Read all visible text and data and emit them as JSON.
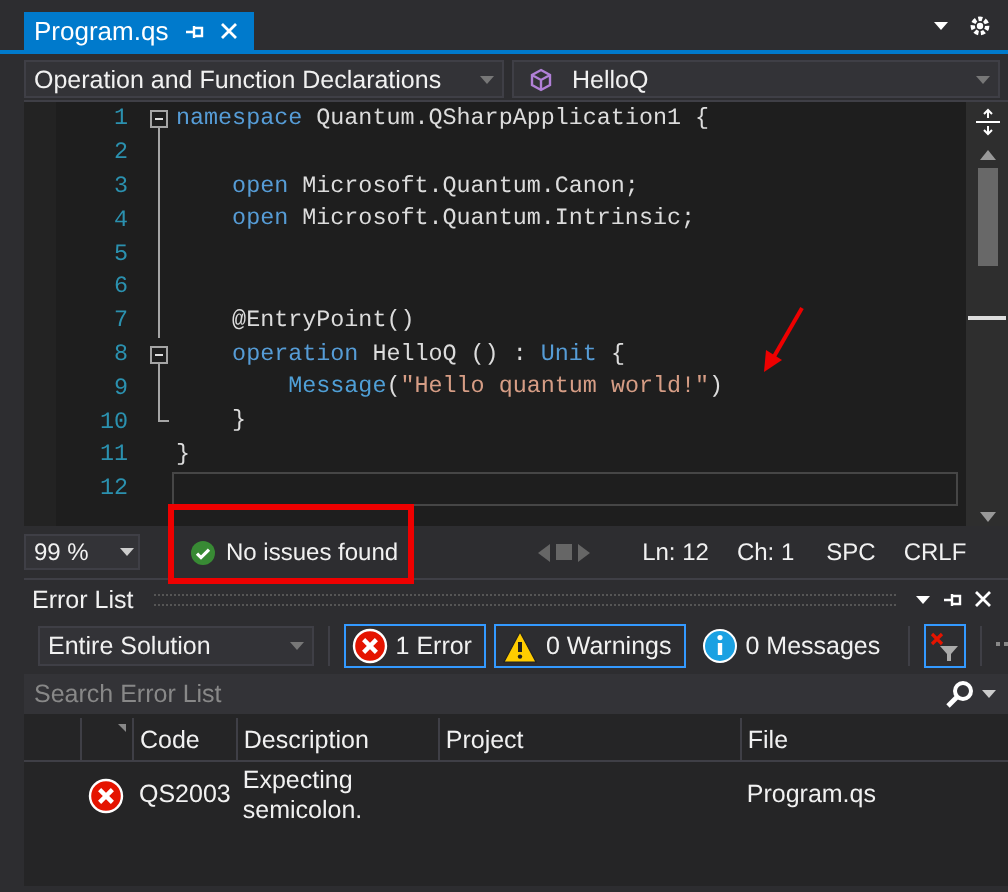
{
  "document_tab": {
    "title": "Program.qs",
    "selected": true
  },
  "navigation": {
    "scope": "Operation and Function Declarations",
    "member": "HelloQ"
  },
  "editor": {
    "lines": [
      {
        "number": "1",
        "kind": "fold-start",
        "current": false,
        "tokens": [
          {
            "text": "namespace",
            "kind": "keyword"
          },
          {
            "text": " Quantum.QSharpApplication1 {",
            "kind": "plain"
          }
        ]
      },
      {
        "number": "2",
        "kind": "fold-line",
        "current": false
      },
      {
        "number": "3",
        "kind": "fold-line",
        "current": false,
        "tokens": [
          {
            "text": "    open",
            "kind": "keyword"
          },
          {
            "text": " Microsoft.Quantum.Canon;",
            "kind": "plain"
          }
        ]
      },
      {
        "number": "4",
        "kind": "fold-line",
        "current": false,
        "tokens": [
          {
            "text": "    open",
            "kind": "keyword"
          },
          {
            "text": " Microsoft.Quantum.Intrinsic;",
            "kind": "plain"
          }
        ]
      },
      {
        "number": "5",
        "kind": "fold-line",
        "current": false
      },
      {
        "number": "6",
        "kind": "fold-line",
        "current": false
      },
      {
        "number": "7",
        "kind": "fold-line",
        "current": false,
        "tokens": [
          {
            "text": "    @EntryPoint()",
            "kind": "plain"
          }
        ]
      },
      {
        "number": "8",
        "kind": "fold-start",
        "current": false,
        "tokens": [
          {
            "text": "    operation",
            "kind": "keyword"
          },
          {
            "text": " HelloQ () : ",
            "kind": "plain"
          },
          {
            "text": "Unit",
            "kind": "keyword"
          },
          {
            "text": " {",
            "kind": "plain"
          }
        ]
      },
      {
        "number": "9",
        "kind": "fold-line",
        "current": false,
        "tokens": [
          {
            "text": "        Message",
            "kind": "function"
          },
          {
            "text": "(",
            "kind": "plain"
          },
          {
            "text": "\"Hello quantum world!\"",
            "kind": "string"
          },
          {
            "text": ")",
            "kind": "plain"
          }
        ]
      },
      {
        "number": "10",
        "kind": "fold-end",
        "current": false,
        "tokens": [
          {
            "text": "    }",
            "kind": "plain"
          }
        ]
      },
      {
        "number": "11",
        "kind": "plain",
        "current": false,
        "tokens": [
          {
            "text": "}",
            "kind": "plain"
          }
        ]
      },
      {
        "number": "12",
        "kind": "plain",
        "current": true
      }
    ]
  },
  "status_bar": {
    "zoom": "99 %",
    "issues": "No issues found",
    "line": "Ln: 12",
    "column": "Ch: 1",
    "indent": "SPC",
    "line_ending": "CRLF"
  },
  "error_list": {
    "title": "Error List",
    "scope": "Entire Solution",
    "filters": [
      {
        "kind": "error",
        "label": "1 Error",
        "selected": true
      },
      {
        "kind": "warning",
        "label": "0 Warnings",
        "selected": true
      },
      {
        "kind": "message",
        "label": "0 Messages",
        "selected": false
      }
    ],
    "build_filter": {
      "selected": true
    },
    "search": {
      "placeholder": "Search Error List"
    },
    "columns": [
      "Code",
      "Description",
      "Project",
      "File"
    ],
    "rows": [
      {
        "kind": "error",
        "code": "QS2003",
        "description": "Expecting semicolon.",
        "file": "Program.qs"
      }
    ]
  }
}
